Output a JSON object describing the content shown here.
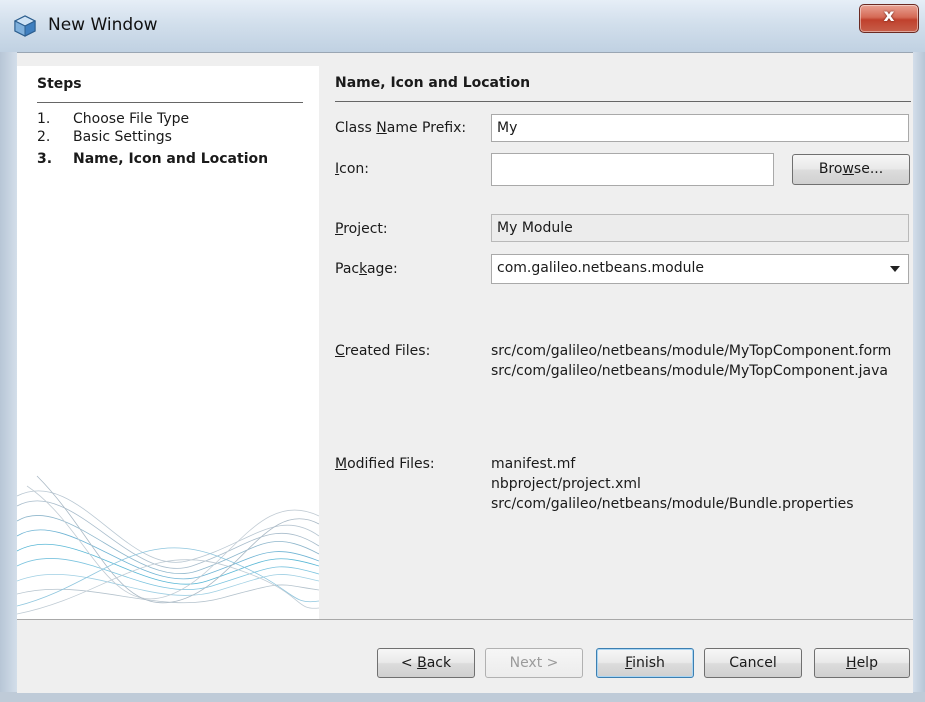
{
  "window": {
    "title": "New Window",
    "close_glyph": "x"
  },
  "icons": {
    "title_icon": "netbeans-cube-icon",
    "dropdown": "chevron-down-icon"
  },
  "steps": {
    "title": "Steps",
    "items": [
      {
        "num": "1.",
        "label": "Choose File Type"
      },
      {
        "num": "2.",
        "label": "Basic Settings"
      },
      {
        "num": "3.",
        "label": "Name, Icon and Location",
        "current": true
      }
    ]
  },
  "form": {
    "section_title": "Name, Icon and Location",
    "class_name_prefix": {
      "label_pre": "Class ",
      "label_mn": "N",
      "label_post": "ame Prefix:",
      "value": "My"
    },
    "icon": {
      "label_mn": "I",
      "label_post": "con:",
      "value": ""
    },
    "browse_button": {
      "pre": "Bro",
      "mn": "w",
      "post": "se..."
    },
    "project": {
      "label_mn": "P",
      "label_post": "roject:",
      "value": "My Module"
    },
    "package": {
      "label_pre": "Pac",
      "label_mn": "k",
      "label_post": "age:",
      "value": "com.galileo.netbeans.module"
    },
    "created_files": {
      "label_mn": "C",
      "label_post": "reated Files:",
      "files": [
        "src/com/galileo/netbeans/module/MyTopComponent.form",
        "src/com/galileo/netbeans/module/MyTopComponent.java"
      ]
    },
    "modified_files": {
      "label_mn": "M",
      "label_post": "odified Files:",
      "files": [
        "manifest.mf",
        "nbproject/project.xml",
        "src/com/galileo/netbeans/module/Bundle.properties"
      ]
    }
  },
  "buttons": {
    "back": {
      "pre": "< ",
      "mn": "B",
      "post": "ack"
    },
    "next": {
      "label": "Next >"
    },
    "finish": {
      "mn": "F",
      "post": "inish"
    },
    "cancel": {
      "label": "Cancel"
    },
    "help": {
      "mn": "H",
      "post": "elp"
    }
  },
  "colors": {
    "close_button": "#c0412d",
    "titlebar": "#d2dfec",
    "default_button_border": "#3c7fb1",
    "wave": "#5bb8d6"
  }
}
